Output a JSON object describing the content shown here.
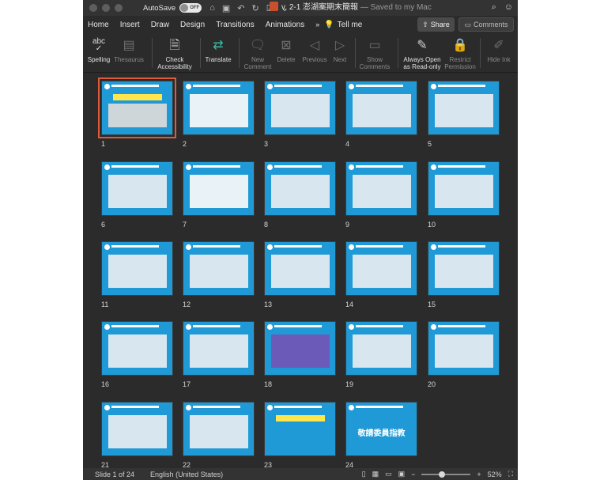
{
  "titlebar": {
    "autosave_label": "AutoSave",
    "autosave_state": "OFF",
    "document_name": "v. 2-1 澎湖案期末簡報",
    "saved_status": "— Saved to my Mac"
  },
  "tabs": [
    "Home",
    "Insert",
    "Draw",
    "Design",
    "Transitions",
    "Animations"
  ],
  "tabs_more": "»",
  "tell_me": "Tell me",
  "share_label": "Share",
  "comments_label": "Comments",
  "toolbar": {
    "spelling": "Spelling",
    "thesaurus": "Thesaurus",
    "check_accessibility_1": "Check",
    "check_accessibility_2": "Accessibility",
    "translate": "Translate",
    "new_comment_1": "New",
    "new_comment_2": "Comment",
    "delete": "Delete",
    "previous": "Previous",
    "next": "Next",
    "show_comments_1": "Show",
    "show_comments_2": "Comments",
    "always_open_1": "Always Open",
    "always_open_2": "as Read-only",
    "restrict_1": "Restrict",
    "restrict_2": "Permission",
    "hide_ink": "Hide Ink"
  },
  "slides": [
    "1",
    "2",
    "3",
    "4",
    "5",
    "6",
    "7",
    "8",
    "9",
    "10",
    "11",
    "12",
    "13",
    "14",
    "15",
    "16",
    "17",
    "18",
    "19",
    "20",
    "21",
    "22",
    "23",
    "24"
  ],
  "slide_24_text": "敬請委員指教",
  "status": {
    "slide_info": "Slide 1 of 24",
    "language": "English (United States)",
    "zoom": "52%"
  },
  "colors": {
    "slide_blue": "#1f9ad6",
    "selected_outline": "#e05a3a",
    "window_bg": "#2b2b2b"
  }
}
